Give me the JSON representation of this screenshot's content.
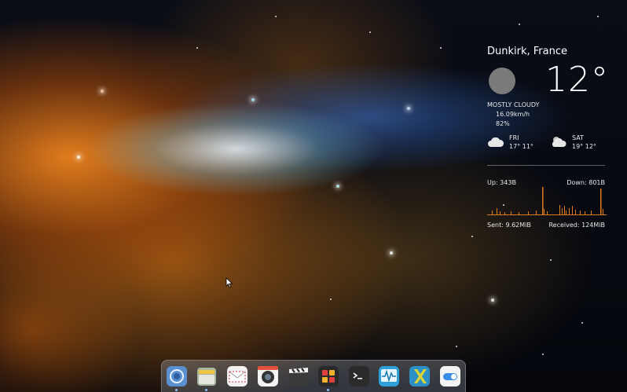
{
  "weather": {
    "city": "Dunkirk, France",
    "temperature": "12°",
    "condition": "MOSTLY CLOUDY",
    "wind": "16.09km/h",
    "humidity": "82%",
    "icon": "moon-icon",
    "forecast": [
      {
        "day": "FRI",
        "temps": "17° 11°",
        "icon": "cloudy-icon"
      },
      {
        "day": "SAT",
        "temps": "19° 12°",
        "icon": "partly-cloudy-icon"
      }
    ]
  },
  "network": {
    "up": "Up: 343B",
    "down": "Down: 801B",
    "sent": "Sent: 9.62MiB",
    "received": "Received: 124MiB",
    "graph_color": "#e07a1f"
  },
  "dock": {
    "apps": [
      {
        "name": "browser",
        "icon": "browser-icon"
      },
      {
        "name": "files",
        "icon": "files-icon"
      },
      {
        "name": "mail",
        "icon": "mail-icon"
      },
      {
        "name": "camera",
        "icon": "camera-icon"
      },
      {
        "name": "videos",
        "icon": "clapperboard-icon"
      },
      {
        "name": "app-center",
        "icon": "app-center-icon"
      },
      {
        "name": "terminal",
        "icon": "terminal-icon"
      },
      {
        "name": "system-monitor",
        "icon": "system-monitor-icon"
      },
      {
        "name": "xfce",
        "icon": "x-logo-icon"
      },
      {
        "name": "settings",
        "icon": "toggle-switch-icon"
      }
    ]
  }
}
